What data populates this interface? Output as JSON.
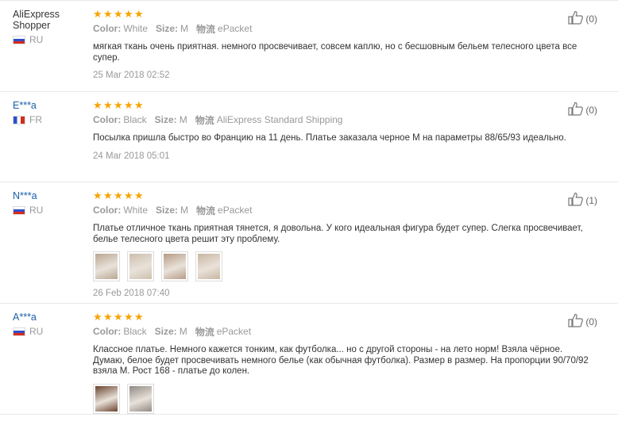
{
  "reviews": [
    {
      "user": "AliExpress Shopper",
      "country": "RU",
      "flag": "ru",
      "color_label": "Color:",
      "color": "White",
      "size_label": "Size:",
      "size": "M",
      "shipping_label": "物流",
      "shipping": "ePacket",
      "text": "мягкая ткань очень приятная. немного просвечивает, совсем каплю, но с бесшовным бельем телесного цвета все супер.",
      "date": "25 Mar 2018 02:52",
      "likes": "(0)",
      "photos": []
    },
    {
      "user": "E***a",
      "country": "FR",
      "flag": "fr",
      "color_label": "Color:",
      "color": "Black",
      "size_label": "Size:",
      "size": "M",
      "shipping_label": "物流",
      "shipping": "AliExpress Standard Shipping",
      "text": "Посылка пришла быстро во Францию на 11 день. Платье заказала черное М на параметры 88/65/93 идеально.",
      "date": "24 Mar 2018 05:01",
      "likes": "(0)",
      "photos": []
    },
    {
      "user": "N***a",
      "country": "RU",
      "flag": "ru",
      "color_label": "Color:",
      "color": "White",
      "size_label": "Size:",
      "size": "M",
      "shipping_label": "物流",
      "shipping": "ePacket",
      "text": "Платье отличное ткань приятная тянется, я довольна. У кого идеальная фигура будет супер. Слегка просвечивает, белье телесного цвета решит эту проблему.",
      "date": "26 Feb 2018 07:40",
      "likes": "(1)",
      "photos": [
        "#b9a792",
        "#cdbfae",
        "#b79c86",
        "#c9b6a3"
      ]
    },
    {
      "user": "A***a",
      "country": "RU",
      "flag": "ru",
      "color_label": "Color:",
      "color": "Black",
      "size_label": "Size:",
      "size": "M",
      "shipping_label": "物流",
      "shipping": "ePacket",
      "text": "Классное платье. Немного кажется тонким, как футболка... но с другой стороны - на лето норм! Взяла чёрное. Думаю, белое будет просвечивать немного белье (как обычная футболка). Размер в размер. На пропорции 90/70/92 взяла М. Рост 168 - платье до колен.",
      "date": "",
      "likes": "(0)",
      "photos": [
        "#6b4330",
        "#8f8a84"
      ]
    }
  ],
  "star_count": 5,
  "colors": {
    "star": "#f7a400",
    "username": "#1a5fa8",
    "muted": "#999999"
  },
  "icons": {
    "rating": "star-icon",
    "like": "thumbs-up-icon"
  }
}
